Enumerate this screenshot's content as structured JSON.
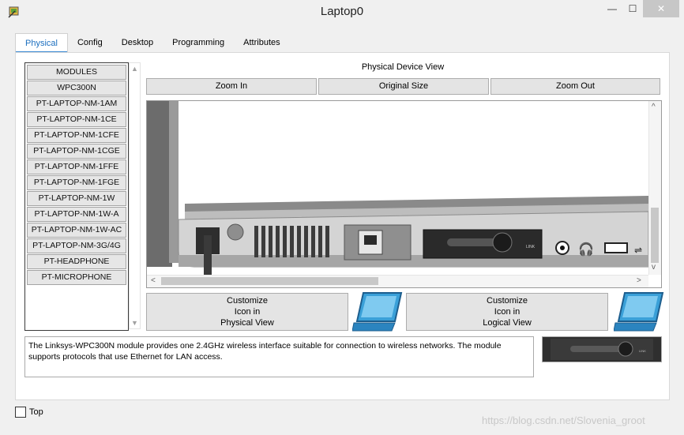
{
  "window": {
    "title": "Laptop0",
    "minimize": "—",
    "maximize": "☐",
    "close": "✕"
  },
  "tabs": [
    {
      "label": "Physical",
      "active": true
    },
    {
      "label": "Config",
      "active": false
    },
    {
      "label": "Desktop",
      "active": false
    },
    {
      "label": "Programming",
      "active": false
    },
    {
      "label": "Attributes",
      "active": false
    }
  ],
  "modules": {
    "header": "MODULES",
    "items": [
      "WPC300N",
      "PT-LAPTOP-NM-1AM",
      "PT-LAPTOP-NM-1CE",
      "PT-LAPTOP-NM-1CFE",
      "PT-LAPTOP-NM-1CGE",
      "PT-LAPTOP-NM-1FFE",
      "PT-LAPTOP-NM-1FGE",
      "PT-LAPTOP-NM-1W",
      "PT-LAPTOP-NM-1W-A",
      "PT-LAPTOP-NM-1W-AC",
      "PT-LAPTOP-NM-3G/4G",
      "PT-HEADPHONE",
      "PT-MICROPHONE"
    ]
  },
  "physical_view": {
    "title": "Physical Device View",
    "zoom_in": "Zoom In",
    "original_size": "Original Size",
    "zoom_out": "Zoom Out",
    "port_label": "LINK"
  },
  "customize": {
    "physical": [
      "Customize",
      "Icon in",
      "Physical View"
    ],
    "logical": [
      "Customize",
      "Icon in",
      "Logical View"
    ]
  },
  "description": "The Linksys-WPC300N module provides one 2.4GHz wireless interface suitable for connection to wireless networks. The module supports protocols that use Ethernet for LAN access.",
  "footer": {
    "top_label": "Top",
    "top_checked": false
  },
  "watermark": "https://blog.csdn.net/Slovenia_groot",
  "colors": {
    "accent": "#3a89d4",
    "tab_active_text": "#1c6fbf",
    "laptop_icon": "#3aa0d8"
  }
}
